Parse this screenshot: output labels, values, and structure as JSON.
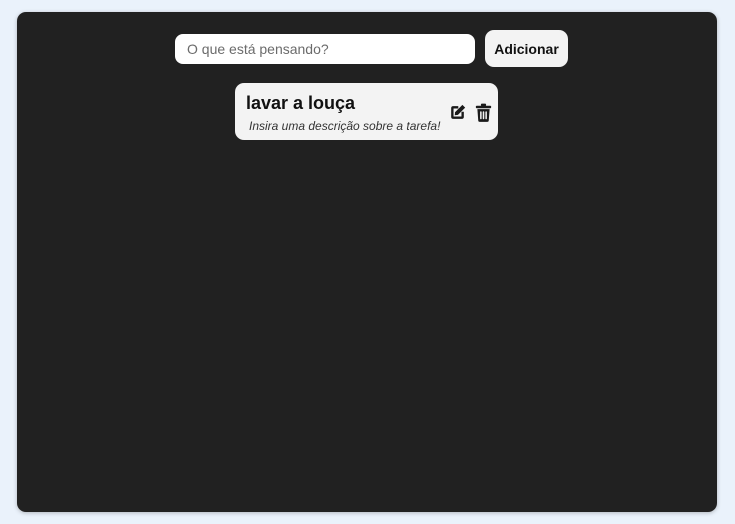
{
  "form": {
    "placeholder": "O que está pensando?",
    "value": "",
    "add_label": "Adicionar"
  },
  "tasks": [
    {
      "title": "lavar a louça",
      "description": "Insira uma descrição sobre a tarefa!",
      "actions": [
        "edit-icon",
        "trash-icon"
      ]
    }
  ],
  "colors": {
    "page_bg": "#eaf2fb",
    "panel_bg": "#212121",
    "card_bg": "#f3f3f3"
  }
}
